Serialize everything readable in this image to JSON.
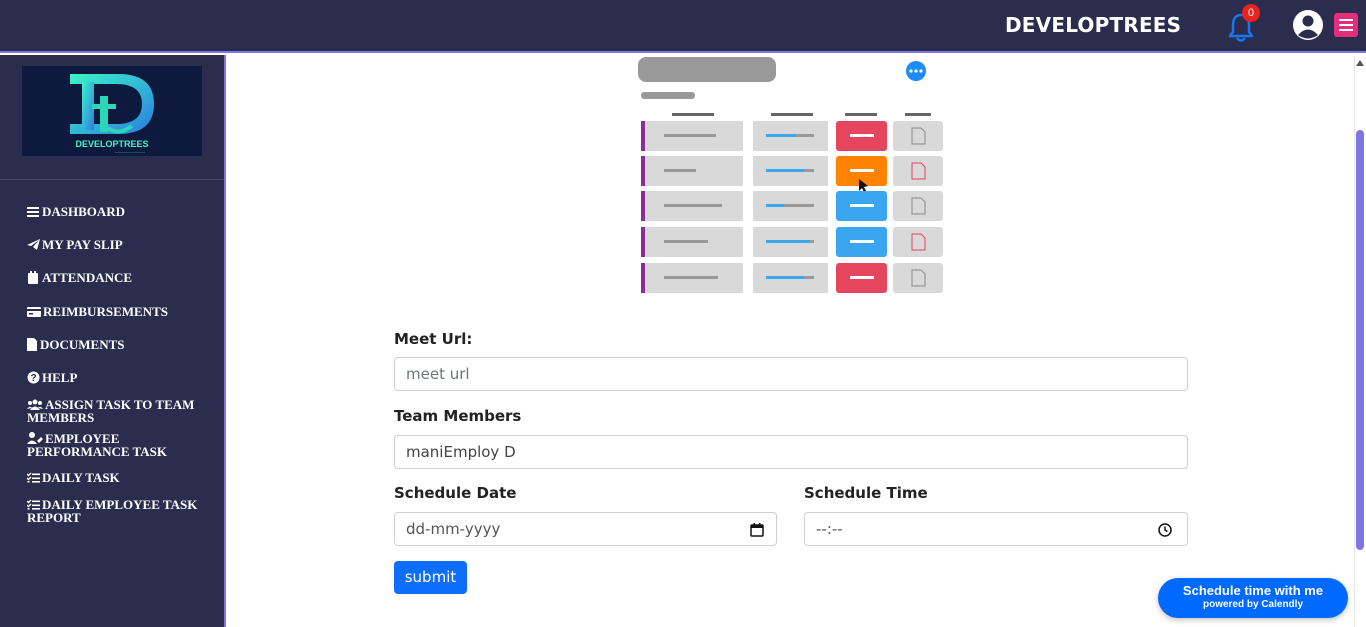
{
  "header": {
    "brand": "DEVELOPTREES",
    "notification_count": "0",
    "icons": [
      "bell-icon",
      "user-circle-icon",
      "menu-icon"
    ],
    "accent_color": "#e82c7c",
    "bg_color": "#2a2d4d"
  },
  "sidebar": {
    "logo_text": "DEVELOPTREES",
    "items": [
      {
        "label": "DASHBOARD",
        "icon": "list-icon"
      },
      {
        "label": "MY PAY SLIP",
        "icon": "paper-plane-icon"
      },
      {
        "label": "ATTENDANCE",
        "icon": "calendar-icon"
      },
      {
        "label": "REIMBURSEMENTS",
        "icon": "credit-card-icon"
      },
      {
        "label": "DOCUMENTS",
        "icon": "file-icon"
      },
      {
        "label": "HELP",
        "icon": "question-circle-icon"
      },
      {
        "label": "ASSIGN TASK TO TEAM MEMBERS",
        "icon": "users-icon"
      },
      {
        "label": "EMPLOYEE PERFORMANCE TASK",
        "icon": "user-edit-icon"
      },
      {
        "label": "DAILY TASK",
        "icon": "tasks-icon"
      },
      {
        "label": "DAILY EMPLOYEE TASK REPORT",
        "icon": "tasks-icon"
      }
    ]
  },
  "form": {
    "meet_url_label": "Meet Url:",
    "meet_url_placeholder": "meet url",
    "team_members_label": "Team Members",
    "team_members_value": "maniEmploy D",
    "schedule_date_label": "Schedule Date",
    "schedule_date_placeholder": "dd-mm-yyyy",
    "schedule_time_label": "Schedule Time",
    "schedule_time_placeholder": "--:--",
    "submit_label": "submit"
  },
  "calendly": {
    "title": "Schedule time with me",
    "subtitle": "powered by Calendly",
    "color": "#0069ff"
  }
}
